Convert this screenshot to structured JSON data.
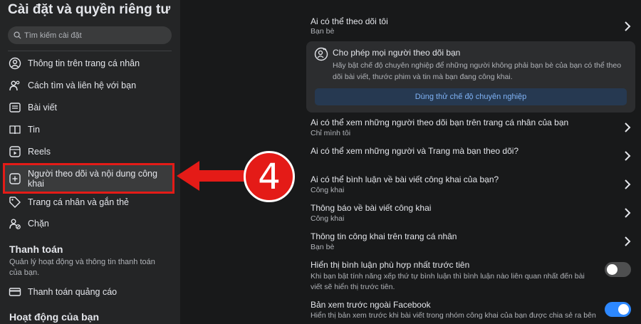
{
  "sidebar": {
    "title": "Cài đặt và quyền riêng tư",
    "search_placeholder": "Tìm kiếm cài đặt",
    "items": [
      {
        "label": "Thông tin trên trang cá nhân"
      },
      {
        "label": "Cách tìm và liên hệ với bạn"
      },
      {
        "label": "Bài viết"
      },
      {
        "label": "Tin"
      },
      {
        "label": "Reels"
      },
      {
        "label": "Người theo dõi và nội dung công khai"
      },
      {
        "label": "Trang cá nhân và gắn thẻ"
      },
      {
        "label": "Chặn"
      }
    ],
    "payments": {
      "heading": "Thanh toán",
      "description": "Quản lý hoạt động và thông tin thanh toán của bạn.",
      "item": "Thanh toán quảng cáo"
    },
    "activity_heading": "Hoạt động của bạn"
  },
  "annotation": {
    "number": "4",
    "color": "#e41b17"
  },
  "main": {
    "who_can_follow": {
      "title": "Ai có thể theo dõi tôi",
      "value": "Bạn bè"
    },
    "pro_card": {
      "title": "Cho phép mọi người theo dõi bạn",
      "description": "Hãy bật chế độ chuyên nghiệp để những người không phải bạn bè của bạn có thể theo dõi bài viết, thước phim và tin mà bạn đang công khai.",
      "button": "Dùng thử chế độ chuyên nghiệp"
    },
    "rows": [
      {
        "title": "Ai có thể xem những người theo dõi bạn trên trang cá nhân của bạn",
        "value": "Chỉ mình tôi"
      },
      {
        "title": "Ai có thể xem những người và Trang mà bạn theo dõi?",
        "value": ""
      },
      {
        "title": "Ai có thể bình luận về bài viết công khai của bạn?",
        "value": "Công khai"
      },
      {
        "title": "Thông báo về bài viết công khai",
        "value": "Công khai"
      },
      {
        "title": "Thông tin công khai trên trang cá nhân",
        "value": "Bạn bè"
      }
    ],
    "toggles": [
      {
        "title": "Hiển thị bình luận phù hợp nhất trước tiên",
        "description": "Khi bạn bật tính năng xếp thứ tự bình luận thì bình luận nào liên quan nhất đến bài viết sẽ hiển thị trước tiên.",
        "enabled": false
      },
      {
        "title": "Bản xem trước ngoài Facebook",
        "description": "Hiển thị bản xem trước khi bài viết trong nhóm công khai của bạn được chia sẻ ra bên",
        "enabled": true
      }
    ]
  },
  "colors": {
    "background": "#18191a",
    "sidebar": "#242526",
    "accent": "#2d88ff",
    "highlight": "#e41b17"
  }
}
